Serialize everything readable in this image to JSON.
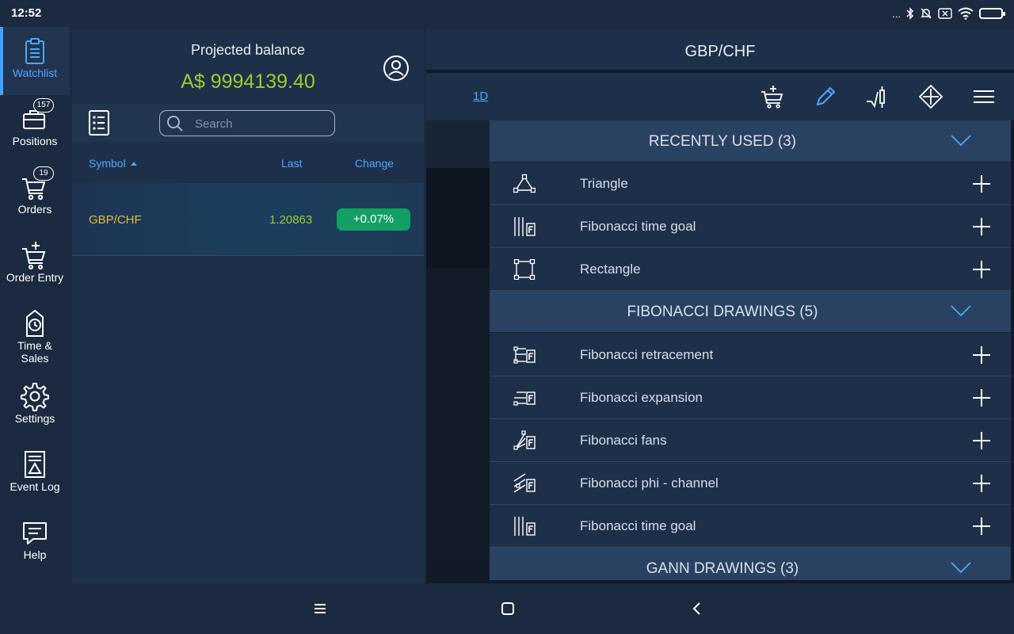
{
  "status_bar": {
    "time": "12:52",
    "dots": "..."
  },
  "left_nav": {
    "items": [
      {
        "label": "Watchlist",
        "icon": "clipboard-icon"
      },
      {
        "label": "Positions",
        "icon": "briefcase-icon",
        "badge": "157"
      },
      {
        "label": "Orders",
        "icon": "cart-icon",
        "badge": "19"
      },
      {
        "label": "Order Entry",
        "icon": "cart-plus-icon"
      },
      {
        "label": "Time &",
        "label2": "Sales",
        "icon": "clock-tag-icon"
      },
      {
        "label": "Settings",
        "icon": "gear-icon"
      },
      {
        "label": "Event Log",
        "icon": "event-log-icon"
      },
      {
        "label": "Help",
        "icon": "chat-help-icon"
      }
    ]
  },
  "watchlist": {
    "balance_label": "Projected balance",
    "balance_value": "A$ 9994139.40",
    "search_placeholder": "Search",
    "columns": {
      "symbol": "Symbol",
      "last": "Last",
      "change": "Change"
    },
    "rows": [
      {
        "symbol": "GBP/CHF",
        "last": "1.20863",
        "change": "+0.07%"
      }
    ]
  },
  "chart": {
    "title": "GBP/CHF",
    "timeframe": "1D"
  },
  "drawings": {
    "sections": [
      {
        "title": "RECENTLY USED (3)",
        "items": [
          "Triangle",
          "Fibonacci time goal",
          "Rectangle"
        ]
      },
      {
        "title": "FIBONACCI DRAWINGS (5)",
        "items": [
          "Fibonacci retracement",
          "Fibonacci expansion",
          "Fibonacci fans",
          "Fibonacci phi - channel",
          "Fibonacci time goal"
        ]
      },
      {
        "title": "GANN DRAWINGS (3)",
        "items": []
      }
    ]
  },
  "colors": {
    "accent": "#49a8ff",
    "balance": "#9acd32",
    "symbol": "#e8b93a",
    "change_positive": "#12a064"
  }
}
